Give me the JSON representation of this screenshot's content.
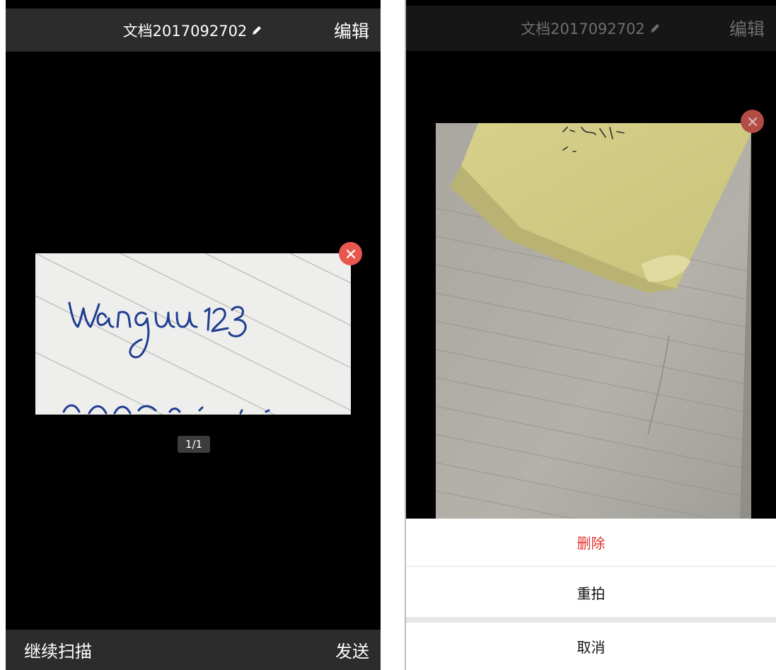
{
  "left_screen": {
    "title": "文档2017092702",
    "edit_label": "编辑",
    "page_indicator": "1/1",
    "continue_scan_label": "继续扫描",
    "send_label": "发送"
  },
  "right_screen": {
    "title": "文档2017092702",
    "edit_label": "编辑",
    "action_sheet": {
      "delete_label": "删除",
      "retake_label": "重拍",
      "cancel_label": "取消"
    }
  },
  "icons": {
    "title_edit": "pencil-icon",
    "remove_page": "close-icon"
  },
  "colors": {
    "navbar": "#2c2c2c",
    "close_badge": "#e8574e",
    "delete_text": "#e0342b"
  }
}
